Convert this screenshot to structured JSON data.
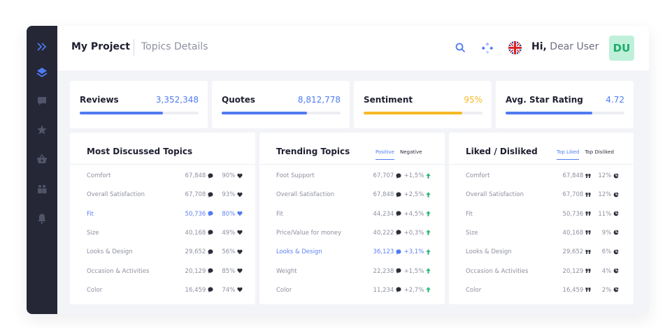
{
  "header": {
    "project_title": "My Project",
    "page_subtitle": "Topics Details",
    "greeting_prefix": "Hi,",
    "greeting_name": "Dear User",
    "avatar_initials": "DU"
  },
  "sidebar": {
    "items": [
      {
        "icon": "chevron-double-right-icon"
      },
      {
        "icon": "layers-icon",
        "active": true
      },
      {
        "icon": "chat-icon"
      },
      {
        "icon": "star-icon"
      },
      {
        "icon": "basket-icon"
      },
      {
        "icon": "users-icon"
      },
      {
        "icon": "bell-icon"
      }
    ]
  },
  "kpis": [
    {
      "label": "Reviews",
      "value": "3,352,348",
      "fill": 0.7,
      "color": "#4f7bf2"
    },
    {
      "label": "Quotes",
      "value": "8,812,778",
      "fill": 0.72,
      "color": "#4f7bf2"
    },
    {
      "label": "Sentiment",
      "value": "95%",
      "fill": 0.83,
      "color": "#f7b924"
    },
    {
      "label": "Avg. Star Rating",
      "value": "4.72",
      "fill": 0.73,
      "color": "#4f7bf2"
    }
  ],
  "panels": {
    "discussed": {
      "title": "Most Discussed Topics",
      "rows": [
        {
          "name": "Comfort",
          "count": "67,848",
          "pct": "90%"
        },
        {
          "name": "Overall Satisfaction",
          "count": "67,708",
          "pct": "93%"
        },
        {
          "name": "Fit",
          "count": "50,736",
          "pct": "80%",
          "highlight": true
        },
        {
          "name": "Size",
          "count": "40,168",
          "pct": "49%"
        },
        {
          "name": "Looks & Design",
          "count": "29,652",
          "pct": "56%"
        },
        {
          "name": "Occasion & Activities",
          "count": "20,129",
          "pct": "85%"
        },
        {
          "name": "Color",
          "count": "16,459",
          "pct": "74%"
        }
      ]
    },
    "trending": {
      "title": "Trending Topics",
      "tabs": [
        "Positive",
        "Negative"
      ],
      "rows": [
        {
          "name": "Foot Support",
          "count": "67,707",
          "change": "+1,5%"
        },
        {
          "name": "Overall Satisfaction",
          "count": "67,848",
          "change": "+2,5%"
        },
        {
          "name": "Fit",
          "count": "44,234",
          "change": "+4,5%"
        },
        {
          "name": "Price/Value for money",
          "count": "40,222",
          "change": "+0,3%"
        },
        {
          "name": "Looks & Design",
          "count": "36,123",
          "change": "+3,1%",
          "highlight": true
        },
        {
          "name": "Weight",
          "count": "22,238",
          "change": "+1,5%"
        },
        {
          "name": "Color",
          "count": "11,234",
          "change": "+2,7%"
        }
      ]
    },
    "liked": {
      "title": "Liked / Disliked",
      "tabs": [
        "Top Liked",
        "Top Disliked"
      ],
      "rows": [
        {
          "name": "Comfort",
          "count": "67,848",
          "pct": "12%"
        },
        {
          "name": "Overall Satisfaction",
          "count": "67,708",
          "pct": "12%"
        },
        {
          "name": "Fit",
          "count": "50,736",
          "pct": "11%"
        },
        {
          "name": "Size",
          "count": "40,168",
          "pct": "9%"
        },
        {
          "name": "Looks & Design",
          "count": "29,652",
          "pct": "6%"
        },
        {
          "name": "Occasion & Activities",
          "count": "20,129",
          "pct": "4%"
        },
        {
          "name": "Color",
          "count": "16,459",
          "pct": "2%"
        }
      ]
    }
  },
  "colors": {
    "accent": "#4f7bf2",
    "sentiment": "#f7b924",
    "trend_up": "#2fb47e",
    "avatar_bg": "#bff0da",
    "avatar_text": "#1dab6d",
    "sidebar_bg": "#252737"
  }
}
